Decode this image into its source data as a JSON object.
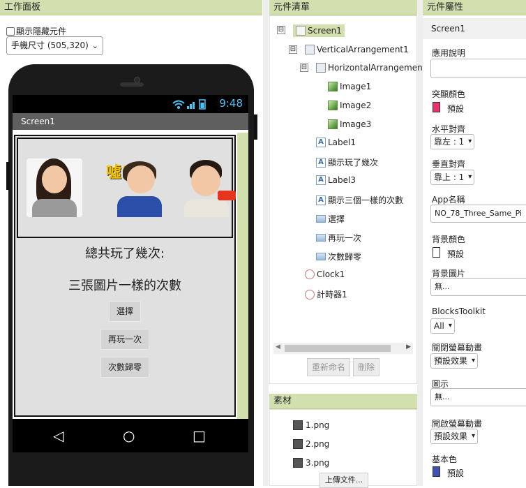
{
  "viewer": {
    "header": "工作面板",
    "show_hidden_label": "顯示隱藏元件",
    "device_size": "手機尺寸 (505,320)",
    "status_time": "9:48",
    "screen_title": "Screen1",
    "label1": "總共玩了幾次:",
    "label3": "三張圖片一樣的次數",
    "btn_select": "選擇",
    "btn_replay": "再玩一次",
    "btn_reset": "次數歸零",
    "shh_text": "噓!"
  },
  "components": {
    "header": "元件清單",
    "tree": [
      {
        "label": "Screen1",
        "toggle": "⊟"
      },
      {
        "label": "VerticalArrangement1",
        "toggle": "⊟"
      },
      {
        "label": "HorizontalArrangemen",
        "toggle": "⊟"
      },
      {
        "label": "Image1"
      },
      {
        "label": "Image2"
      },
      {
        "label": "Image3"
      },
      {
        "label": "Label1"
      },
      {
        "label": "顯示玩了幾次"
      },
      {
        "label": "Label3"
      },
      {
        "label": "顯示三個一樣的次數"
      },
      {
        "label": "選擇"
      },
      {
        "label": "再玩一次"
      },
      {
        "label": "次數歸零"
      },
      {
        "label": "Clock1"
      },
      {
        "label": "計時器1"
      }
    ],
    "rename_button": "重新命名",
    "delete_button": "刪除"
  },
  "media": {
    "header": "素材",
    "files": [
      "1.png",
      "2.png",
      "3.png"
    ],
    "upload_button": "上傳文件..."
  },
  "properties": {
    "header": "元件屬性",
    "component_name": "Screen1",
    "about_label": "應用說明",
    "about_value": "",
    "accent_label": "突顯顏色",
    "accent_value": "預設",
    "accent_color": "#e8336b",
    "halign_label": "水平對齊",
    "halign_value": "靠左 : 1",
    "valign_label": "垂直對齊",
    "valign_value": "靠上 : 1",
    "appname_label": "App名稱",
    "appname_value": "NO_78_Three_Same_Pi",
    "bgcolor_label": "背景顏色",
    "bgcolor_value": "預設",
    "bgcolor_color": "#ffffff",
    "bgimage_label": "背景圖片",
    "bgimage_value": "無...",
    "blocks_label": "BlocksToolkit",
    "blocks_value": "All",
    "close_anim_label": "關閉螢幕動畫",
    "close_anim_value": "預設效果",
    "icon_label": "圖示",
    "icon_value": "無...",
    "open_anim_label": "開啟螢幕動畫",
    "open_anim_value": "預設效果",
    "primary_label": "基本色",
    "primary_value": "預設",
    "primary_color": "#3f51b5"
  }
}
